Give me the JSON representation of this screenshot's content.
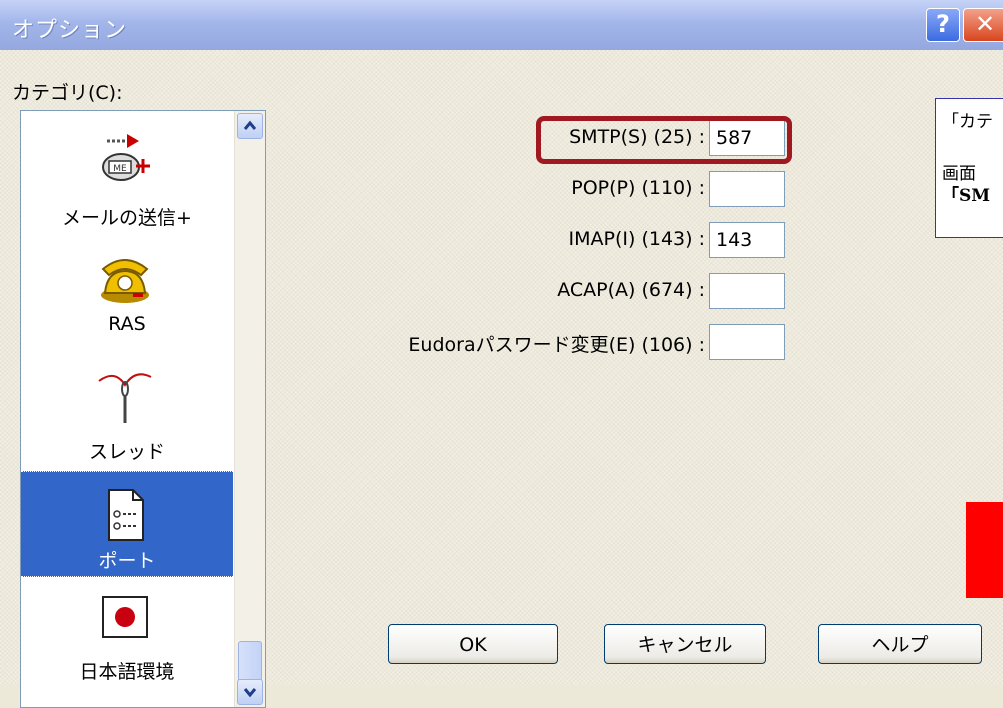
{
  "window": {
    "title": "オプション",
    "help_button": "?",
    "close_button": "✕"
  },
  "category": {
    "label": "カテゴリ(C):",
    "items": [
      {
        "label": "メールの送信+",
        "icon": "send-mail-plus-icon",
        "selected": false
      },
      {
        "label": "RAS",
        "icon": "telephone-icon",
        "selected": false
      },
      {
        "label": "スレッド",
        "icon": "needle-thread-icon",
        "selected": false
      },
      {
        "label": "ポート",
        "icon": "port-settings-icon",
        "selected": true
      },
      {
        "label": "日本語環境",
        "icon": "japan-flag-icon",
        "selected": false
      }
    ]
  },
  "ports": [
    {
      "label": "SMTP(S) (25) :",
      "value": "587"
    },
    {
      "label": "POP(P) (110) :",
      "value": ""
    },
    {
      "label": "IMAP(I) (143) :",
      "value": "143"
    },
    {
      "label": "ACAP(A) (674) :",
      "value": ""
    },
    {
      "label": "Eudoraパスワード変更(E) (106) :",
      "value": ""
    }
  ],
  "annotation": {
    "line1": "「カテ",
    "line2": "画面",
    "line3": "「SM"
  },
  "buttons": {
    "ok": "OK",
    "cancel": "キャンセル",
    "help": "ヘルプ"
  },
  "colors": {
    "selection": "#3266c8",
    "highlight_border": "#a01820",
    "red_block": "#ff0000"
  }
}
